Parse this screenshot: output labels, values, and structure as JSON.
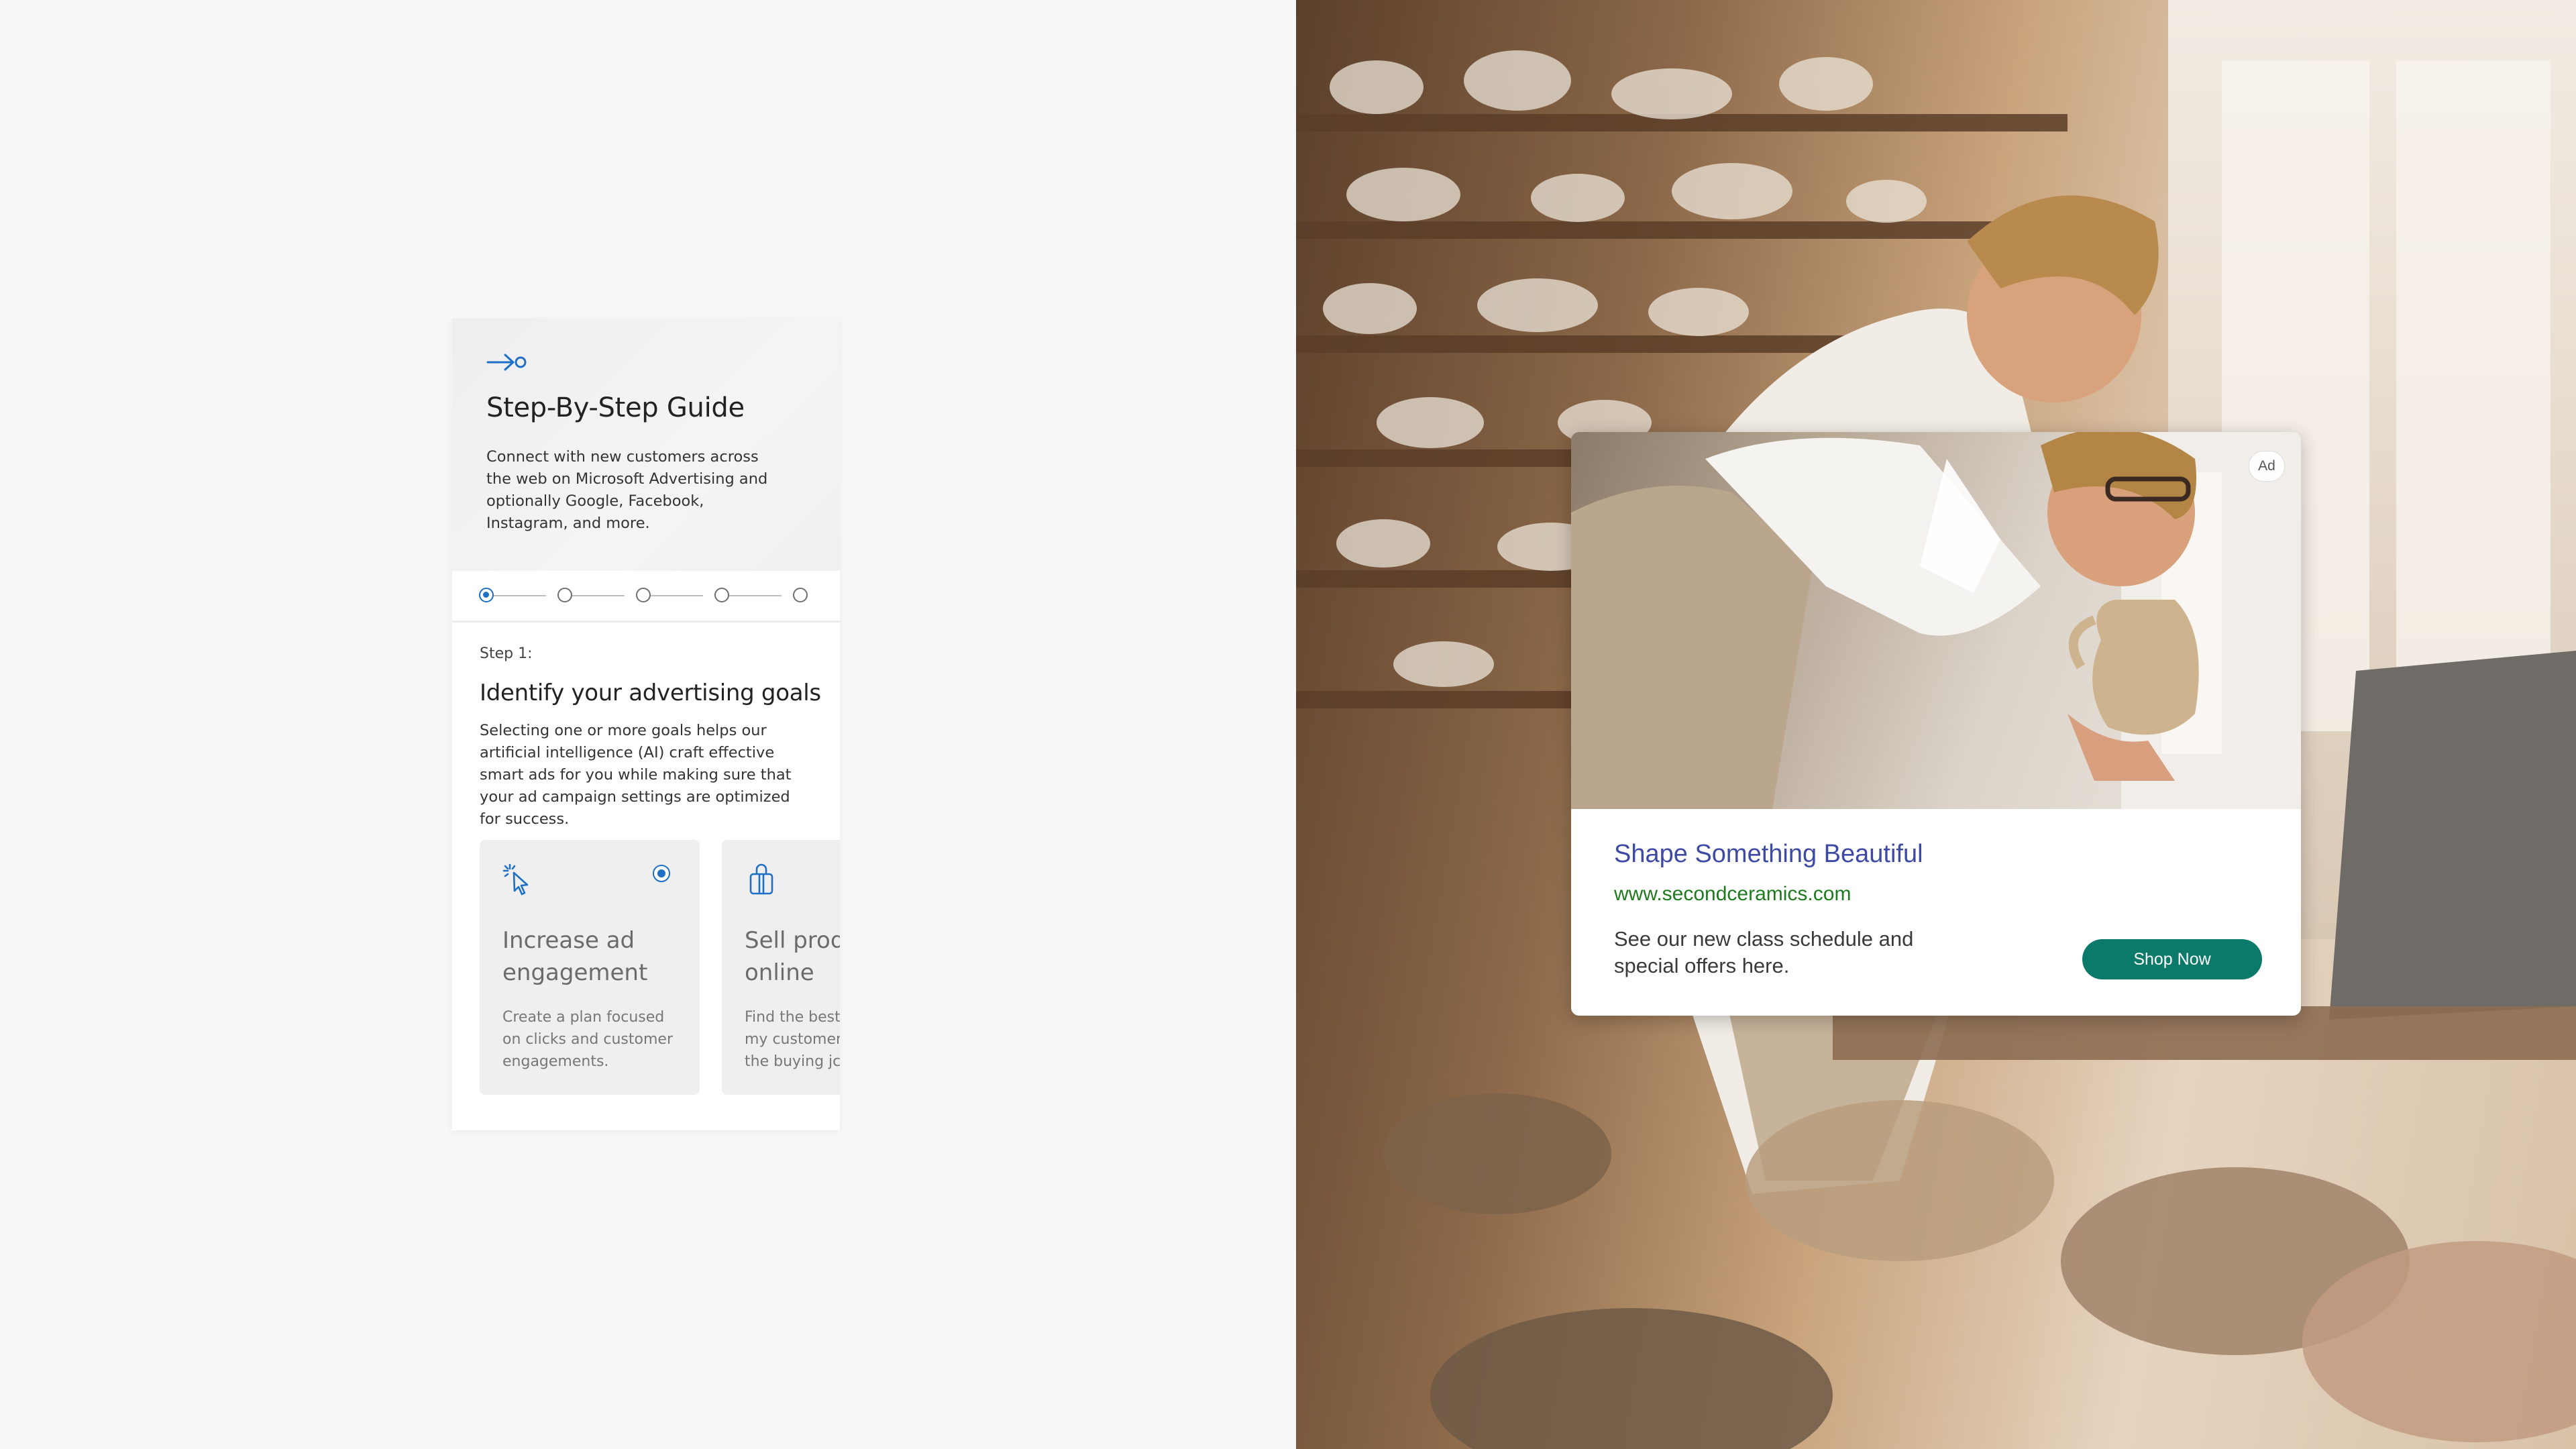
{
  "guide": {
    "icon": "arrow-to-circle-icon",
    "title": "Step-By-Step Guide",
    "description": "Connect with new customers across the web on Microsoft Advertising and optionally Google, Facebook, Instagram, and more."
  },
  "stepper": {
    "total_steps": 5,
    "current_step": 1
  },
  "step": {
    "label": "Step 1:",
    "title": "Identify your advertising goals",
    "description": "Selecting one or more goals helps our artificial intelligence (AI) craft effective smart ads for you while making sure that your ad campaign settings are optimized for success."
  },
  "goals": [
    {
      "icon": "click-cursor-icon",
      "title": "Increase ad\nengagement",
      "description": "Create a plan focused\non clicks and customer\nengagements.",
      "selected": true
    },
    {
      "icon": "shopping-bag-icon",
      "title": "Sell prod\nonline",
      "description": "Find the best\nmy customer\nthe buying jc",
      "selected": false
    }
  ],
  "ad": {
    "badge": "Ad",
    "headline": "Shape Something Beautiful",
    "url": "www.secondceramics.com",
    "description": "See our new class schedule and special offers here.",
    "cta": "Shop Now"
  },
  "colors": {
    "accent": "#1e6fc6",
    "ad_headline": "#3d4ba4",
    "ad_url": "#1f7a1f",
    "cta_background": "#0b7a6a",
    "page_background": "#f7f7f7"
  }
}
